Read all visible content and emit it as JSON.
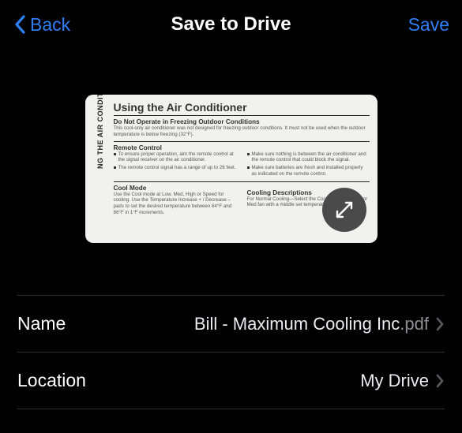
{
  "header": {
    "back_label": "Back",
    "title": "Save to Drive",
    "save_label": "Save"
  },
  "preview": {
    "side_label": "NG THE AIR CONDITIONER",
    "title": "Using the Air Conditioner",
    "section1_heading": "Do Not Operate in Freezing Outdoor Conditions",
    "section1_body": "This cool-only air conditioner was not designed for freezing outdoor conditions. It must not be used when the outdoor temperature is below freezing (32°F).",
    "section2_heading": "Remote Control",
    "section2_left_a": "To ensure proper operation, aim the remote control at the signal receiver on the air conditioner.",
    "section2_left_b": "The remote control signal has a range of up to 26 feet.",
    "section2_right_a": "Make sure nothing is between the air conditioner and the remote control that could block the signal.",
    "section2_right_b": "Make sure batteries are fresh and installed properly as indicated on the remote control.",
    "section3_heading": "Cool Mode",
    "section3_body": "Use the Cool mode at Low, Med, High or Speed for cooling. Use the Temperature Increase + / Decrease – pads to set the desired temperature between 64°F and 86°F in 1°F increments.",
    "section3_right_heading": "Cooling Descriptions",
    "section3_right_body": "For Normal Cooling—Select the Cool mode and High or Med fan with a middle set temperature."
  },
  "settings": {
    "name_label": "Name",
    "filename_main": "Bill - Maximum Cooling Inc",
    "filename_ext": ".pdf",
    "location_label": "Location",
    "location_value": "My Drive"
  }
}
